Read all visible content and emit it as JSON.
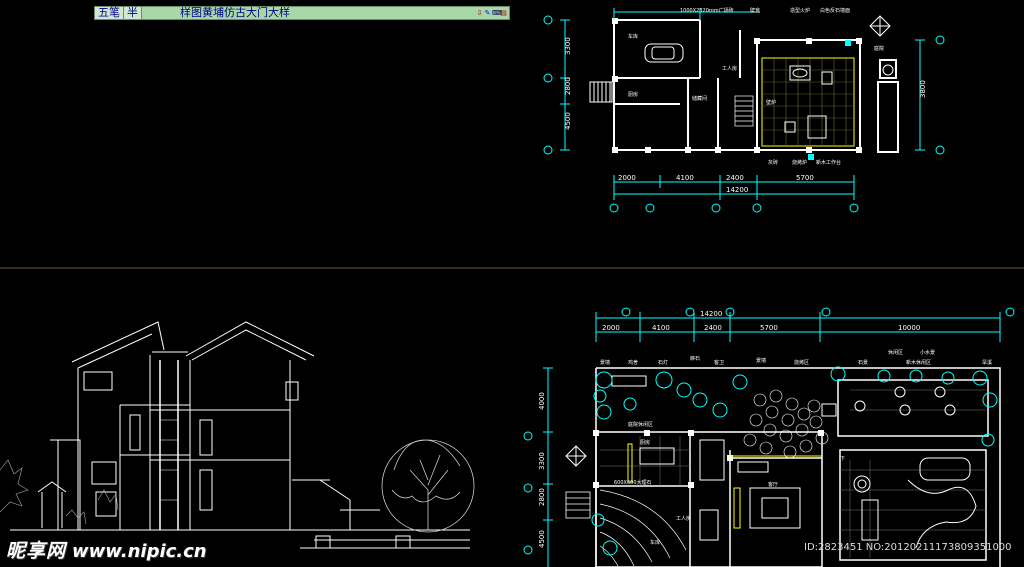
{
  "ime_bar": {
    "mode": "五笔",
    "width_mode": "半",
    "candidate": "样图黄埔仿古大门大样",
    "icons": [
      "pin-icon",
      "tools-icon",
      "keyboard-icon",
      "menu-icon"
    ]
  },
  "top_plan": {
    "dims_bottom": [
      "2000",
      "4100",
      "2400",
      "5700"
    ],
    "total": "14200",
    "dims_left": [
      "3300",
      "2800",
      "4500"
    ],
    "dims_right": [
      "3800"
    ],
    "labels": [
      "1000X2320mm广场砖",
      "壁龛",
      "造型火炉",
      "白色反石墙面",
      "车库",
      "工人房",
      "厨房",
      "储藏间",
      "壁炉",
      "灰砖",
      "烧烤炉",
      "新木工作台",
      "庭院"
    ]
  },
  "bottom_plan": {
    "dims_top": [
      "2000",
      "4100",
      "2400",
      "5700",
      "10000"
    ],
    "total": "14200",
    "dims_left": [
      "4000",
      "3300",
      "2800",
      "4500"
    ],
    "labels": [
      "景墙",
      "鸡舍",
      "石灯",
      "麻石",
      "客卫",
      "景墙",
      "烧烤区",
      "石景",
      "休闲区",
      "小水景",
      "新木休闲区",
      "旱溪",
      "庭院休闲区",
      "600X600大理石",
      "客厅",
      "厨房",
      "工人房",
      "车库",
      "下"
    ]
  },
  "watermark": {
    "brand": "昵享网",
    "url": "www.nipic.cn",
    "id_text": "ID:2823451 NO:20120211173809351000"
  }
}
